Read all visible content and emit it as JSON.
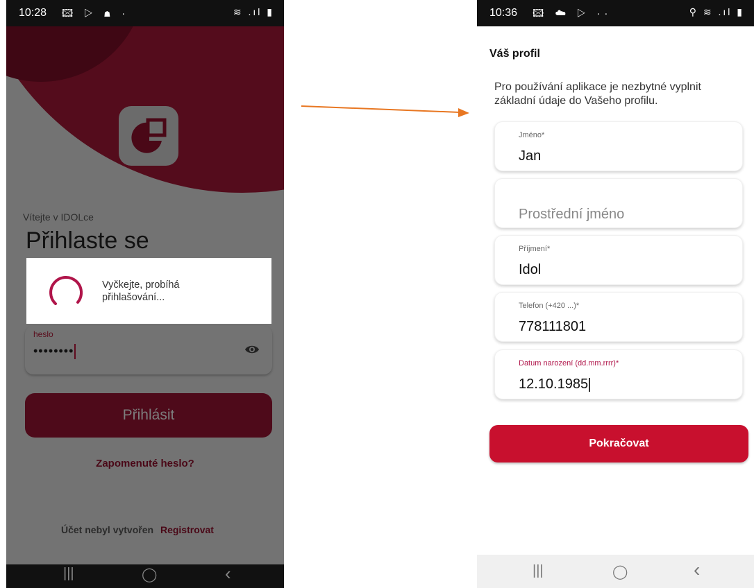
{
  "left_phone": {
    "status": {
      "time": "10:28",
      "icons": "🖾 ▷ ☗ ·",
      "right": "≋ .ıl ▮"
    },
    "welcome": "Vítejte v IDOLce",
    "title": "Přihlaste se",
    "dialog": {
      "message": "Vyčkejte, probíhá přihlašování..."
    },
    "password": {
      "label": "heslo",
      "value": "••••••••"
    },
    "login_button": "Přihlásit",
    "forgot_password": "Zapomenuté heslo?",
    "no_account": "Účet nebyl vytvořen",
    "register": "Registrovat",
    "nav": {
      "recent": "|||",
      "home": "◯",
      "back": "‹"
    }
  },
  "right_phone": {
    "status": {
      "time": "10:36",
      "icons": "🖾 ☁ ▷ ··",
      "right": "⚲ ≋ .ıl ▮"
    },
    "title": "Váš profil",
    "intro": "Pro používání aplikace je nezbytné vyplnit základní údaje do Vašeho profilu.",
    "fields": [
      {
        "label": "Jméno*",
        "value": "Jan"
      },
      {
        "label": "",
        "placeholder": "Prostřední jméno"
      },
      {
        "label": "Příjmení*",
        "value": "Idol"
      },
      {
        "label": "Telefon (+420 ...)*",
        "value": "778111801"
      },
      {
        "label": "Datum narození (dd.mm.rrrr)*",
        "value": "12.10.1985"
      }
    ],
    "continue_button": "Pokračovat",
    "nav": {
      "recent": "|||",
      "home": "◯",
      "back": "‹"
    }
  },
  "colors": {
    "brand_red": "#c8102e",
    "dark_red": "#540c1c",
    "active_label": "#b0154a",
    "arrow": "#e87722"
  }
}
